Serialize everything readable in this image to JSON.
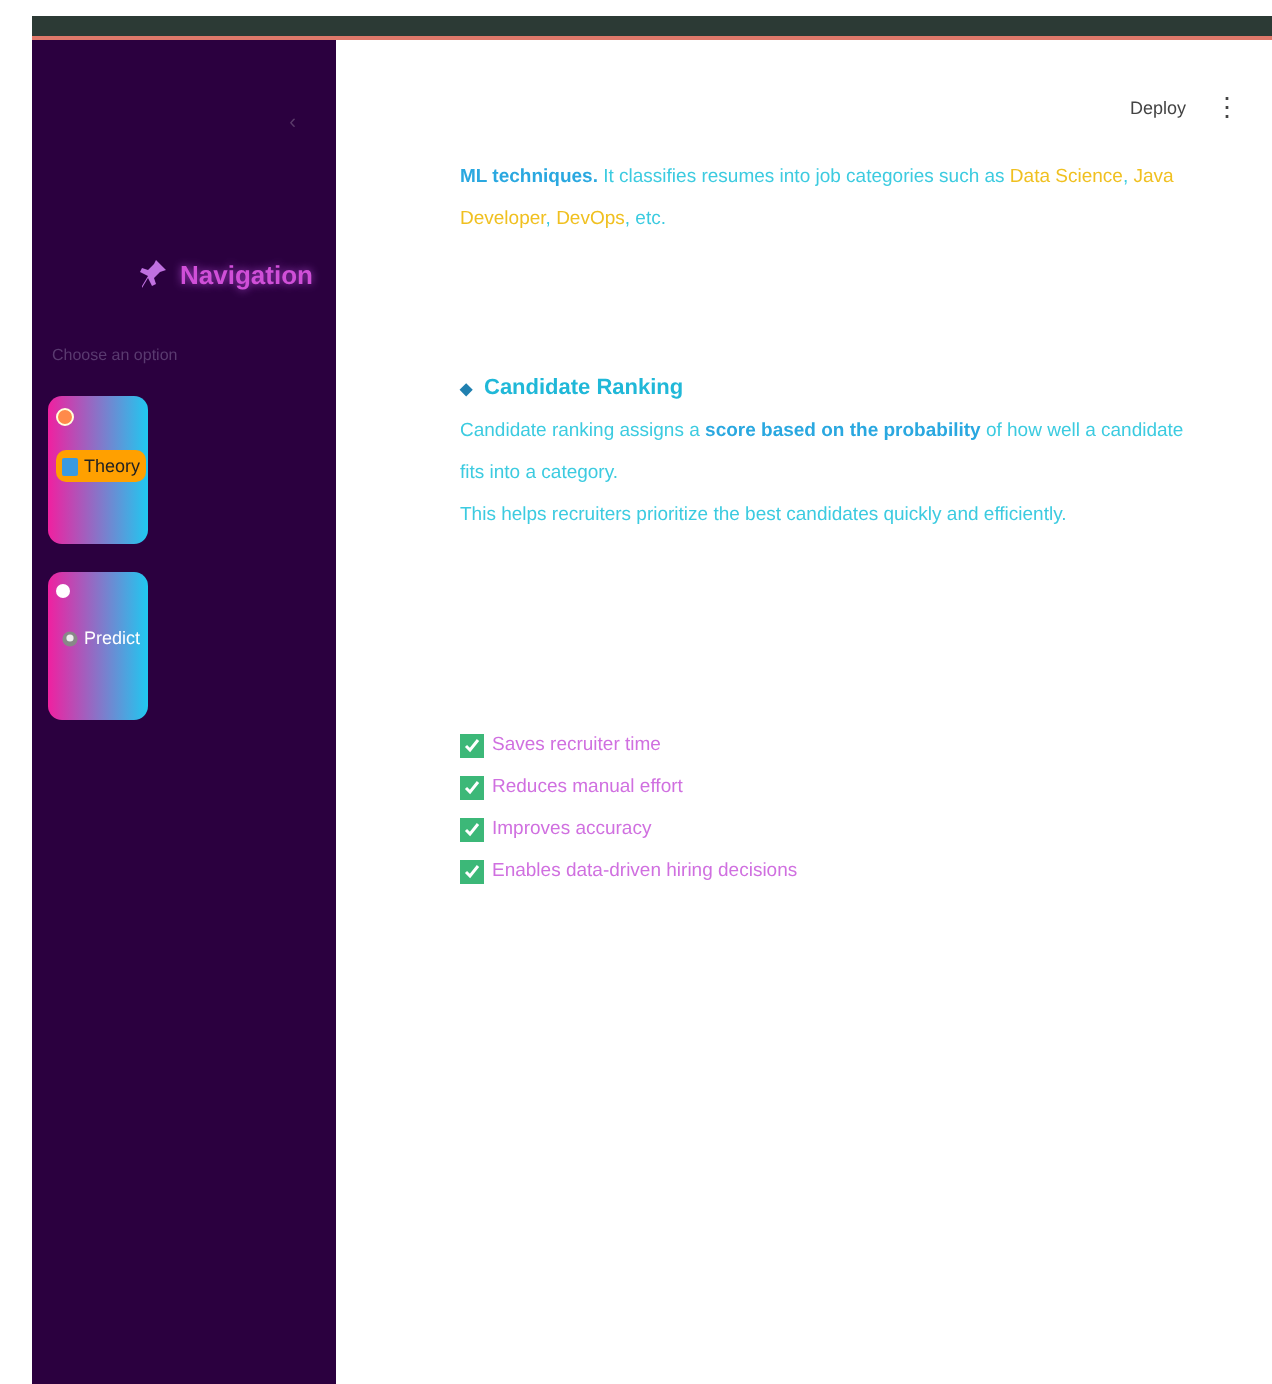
{
  "toolbar": {
    "deploy": "Deploy",
    "menu": "⋮"
  },
  "sidebar": {
    "collapse": "‹",
    "title": "Navigation",
    "prompt": "Choose an option",
    "items": [
      {
        "label": "Theory",
        "selected": true
      },
      {
        "label": "Predict",
        "selected": false
      }
    ]
  },
  "content": {
    "intro": [
      {
        "kind": "bold",
        "text": "ML techniques."
      },
      {
        "kind": "plain",
        "text": " It classifies resumes into job categories such as "
      },
      {
        "kind": "highlight",
        "text": "Data Science"
      },
      {
        "kind": "plain",
        "text": ", "
      },
      {
        "kind": "highlight",
        "text": "Java Developer"
      },
      {
        "kind": "plain",
        "text": ", "
      },
      {
        "kind": "highlight",
        "text": "DevOps"
      },
      {
        "kind": "plain",
        "text": ", etc."
      }
    ],
    "section": {
      "bullet": "◆",
      "heading": "Candidate Ranking",
      "paragraph": "Candidate ranking assigns a **score based on the probability** of how well a candidate fits into a category.",
      "note": "This helps recruiters prioritize the best candidates quickly and efficiently."
    },
    "benefits": [
      {
        "label": "Saves recruiter time",
        "checked": true
      },
      {
        "label": "Reduces manual effort",
        "checked": true
      },
      {
        "label": "Improves accuracy",
        "checked": true
      },
      {
        "label": "Enables data-driven hiring decisions",
        "checked": true
      }
    ]
  }
}
